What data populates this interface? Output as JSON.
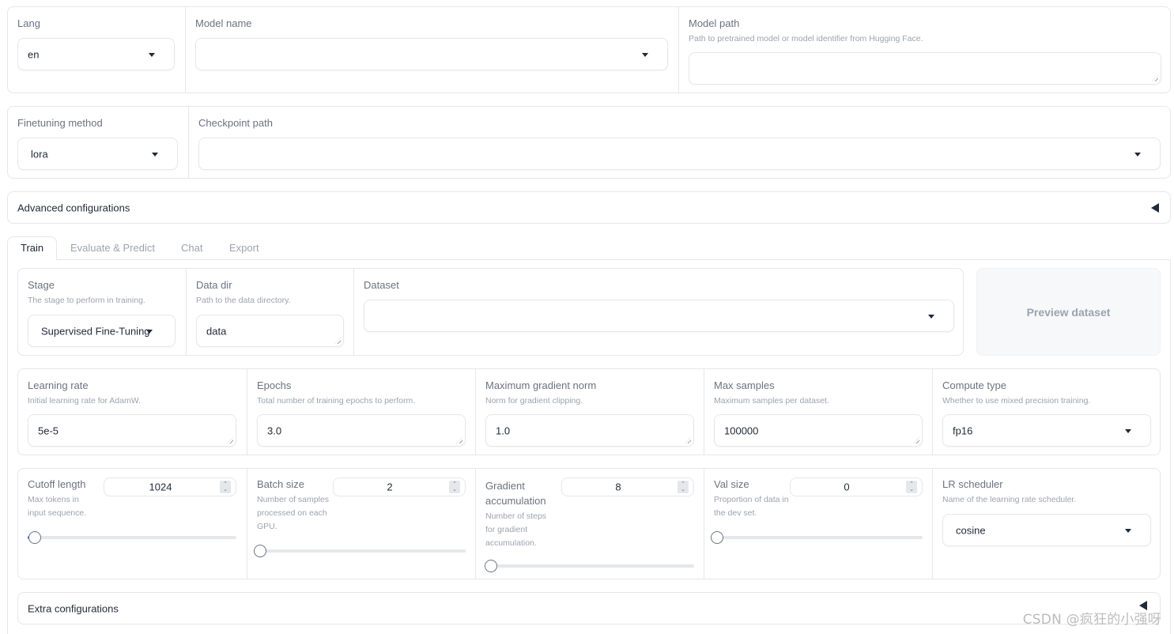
{
  "top": {
    "lang": {
      "label": "Lang",
      "value": "en"
    },
    "model_name": {
      "label": "Model name",
      "value": ""
    },
    "model_path": {
      "label": "Model path",
      "info": "Path to pretrained model or model identifier from Hugging Face.",
      "value": ""
    }
  },
  "second": {
    "finetuning_method": {
      "label": "Finetuning method",
      "value": "lora"
    },
    "checkpoint_path": {
      "label": "Checkpoint path",
      "value": ""
    }
  },
  "advanced": {
    "label": "Advanced configurations"
  },
  "tabs": [
    {
      "label": "Train",
      "active": true
    },
    {
      "label": "Evaluate & Predict",
      "active": false
    },
    {
      "label": "Chat",
      "active": false
    },
    {
      "label": "Export",
      "active": false
    }
  ],
  "train": {
    "stage": {
      "label": "Stage",
      "info": "The stage to perform in training.",
      "value": "Supervised Fine-Tuning"
    },
    "data_dir": {
      "label": "Data dir",
      "info": "Path to the data directory.",
      "value": "data"
    },
    "dataset": {
      "label": "Dataset",
      "value": ""
    },
    "preview_button": "Preview dataset",
    "learning_rate": {
      "label": "Learning rate",
      "info": "Initial learning rate for AdamW.",
      "value": "5e-5"
    },
    "epochs": {
      "label": "Epochs",
      "info": "Total number of training epochs to perform.",
      "value": "3.0"
    },
    "max_grad_norm": {
      "label": "Maximum gradient norm",
      "info": "Norm for gradient clipping.",
      "value": "1.0"
    },
    "max_samples": {
      "label": "Max samples",
      "info": "Maximum samples per dataset.",
      "value": "100000"
    },
    "compute_type": {
      "label": "Compute type",
      "info": "Whether to use mixed precision training.",
      "value": "fp16"
    },
    "cutoff_length": {
      "label": "Cutoff length",
      "info": "Max tokens in input sequence.",
      "value": "1024",
      "slider_fraction": 0.02
    },
    "batch_size": {
      "label": "Batch size",
      "info": "Number of samples processed on each GPU.",
      "value": "2",
      "slider_fraction": 0.0
    },
    "grad_accum": {
      "label": "Gradient accumulation",
      "info": "Number of steps for gradient accumulation.",
      "value": "8",
      "slider_fraction": 0.01
    },
    "val_size": {
      "label": "Val size",
      "info": "Proportion of data in the dev set.",
      "value": "0",
      "slider_fraction": 0.0
    },
    "lr_scheduler": {
      "label": "LR scheduler",
      "info": "Name of the learning rate scheduler.",
      "value": "cosine"
    },
    "extra": {
      "label": "Extra configurations"
    }
  },
  "watermark": "CSDN @疯狂的小强呀",
  "colors": {
    "accent": "#2563eb",
    "border": "#e5e7eb",
    "label": "#6b7280",
    "info": "#9ca3af"
  }
}
